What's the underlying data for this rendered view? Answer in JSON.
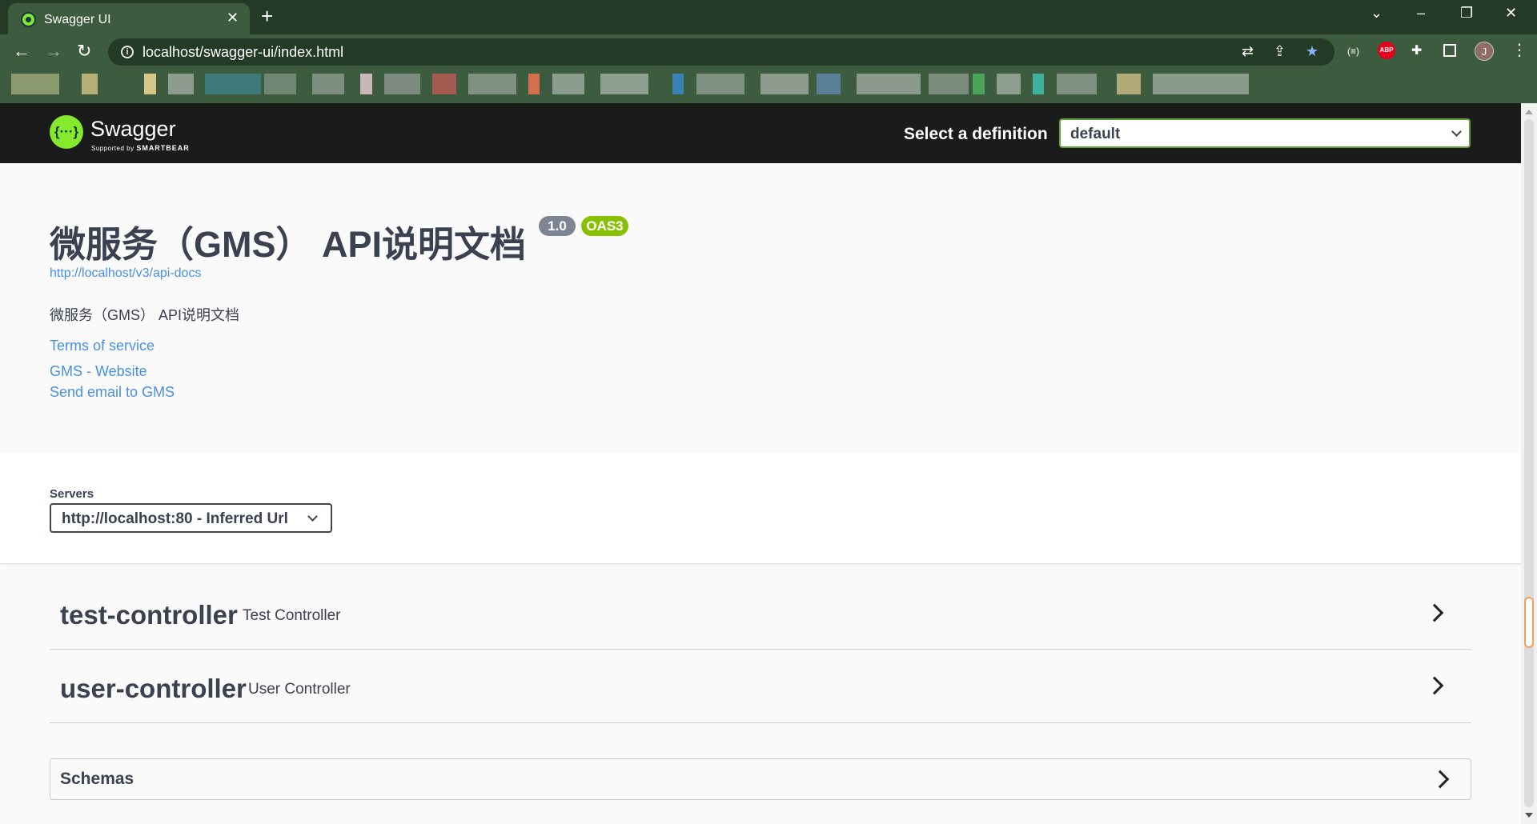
{
  "browser": {
    "tab_title": "Swagger UI",
    "tab_close": "✕",
    "new_tab": "+",
    "url": "localhost/swagger-ui/index.html",
    "profile_initial": "J",
    "abp_label": "ABP",
    "window_controls": {
      "dropdown": "⌄",
      "minimize": "–",
      "restore": "❐",
      "close": "✕"
    },
    "nav": {
      "back": "←",
      "forward": "→",
      "reload": "↻"
    }
  },
  "topbar": {
    "logo_symbol": "{···}",
    "logo_text": "Swagger",
    "logo_sub_prefix": "Supported by ",
    "logo_sub_brand": "SMARTBEAR",
    "select_definition_label": "Select a definition",
    "definition_value": "default"
  },
  "info": {
    "title": "微服务（GMS） API说明文档",
    "version_badge": "1.0",
    "oas_badge": "OAS3",
    "spec_url": "http://localhost/v3/api-docs",
    "description": "微服务（GMS） API说明文档",
    "terms_link": "Terms of service",
    "website_link": "GMS - Website",
    "email_link": "Send email to GMS"
  },
  "servers": {
    "label": "Servers",
    "selected": "http://localhost:80 - Inferred Url"
  },
  "tags": [
    {
      "name": "test-controller",
      "description": "Test Controller"
    },
    {
      "name": "user-controller",
      "description": "User Controller"
    }
  ],
  "schemas": {
    "title": "Schemas"
  },
  "colors": {
    "browser_frame": "#223a26",
    "browser_toolbar": "#3d5b3e",
    "swagger_topbar": "#1b1b1b",
    "swagger_green": "#85ea2d",
    "link_blue": "#4990e2",
    "oas_badge": "#89bf04",
    "version_badge": "#7d8492",
    "text_dark": "#3b4151"
  }
}
